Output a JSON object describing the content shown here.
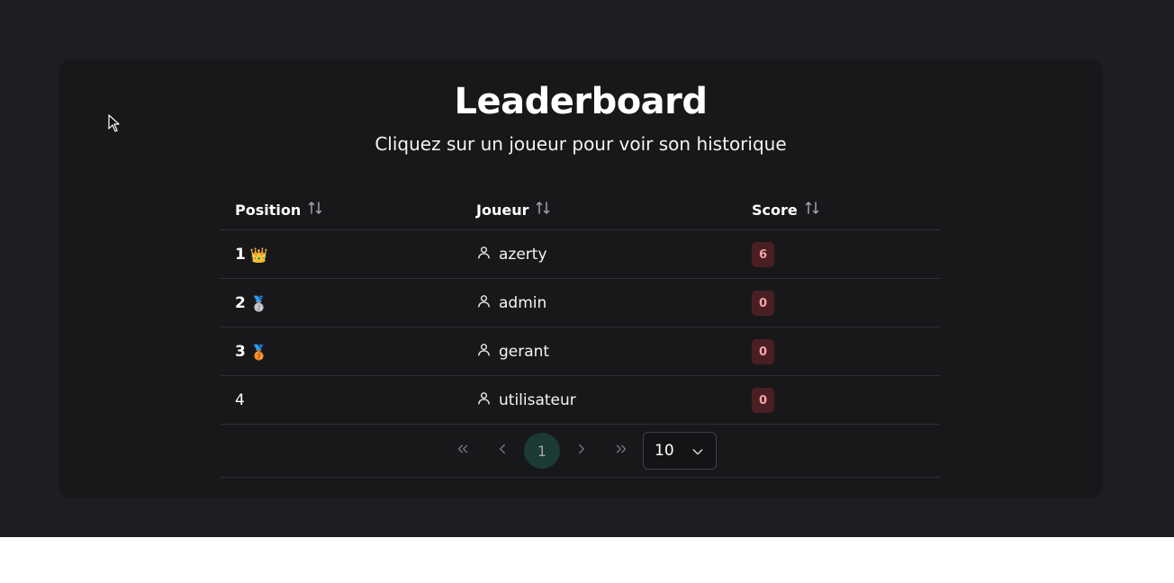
{
  "header": {
    "title": "Leaderboard",
    "subtitle": "Cliquez sur un joueur pour voir son historique"
  },
  "table": {
    "columns": [
      {
        "label": "Position",
        "icon": "sort-icon"
      },
      {
        "label": "Joueur",
        "icon": "sort-icon"
      },
      {
        "label": "Score",
        "icon": "sort-icon"
      }
    ],
    "rows": [
      {
        "position": "1",
        "medal": "👑",
        "medal_icon": "crown-icon",
        "player": "azerty",
        "score": "6"
      },
      {
        "position": "2",
        "medal": "🥈",
        "medal_icon": "silver-medal-icon",
        "player": "admin",
        "score": "0"
      },
      {
        "position": "3",
        "medal": "🥉",
        "medal_icon": "bronze-medal-icon",
        "player": "gerant",
        "score": "0"
      },
      {
        "position": "4",
        "medal": "",
        "medal_icon": "",
        "player": "utilisateur",
        "score": "0"
      }
    ]
  },
  "pagination": {
    "current_page": "1",
    "page_size": "10"
  },
  "colors": {
    "background": "#1e1d23",
    "card": "#18181b",
    "score_badge_bg": "#4a1f23",
    "score_badge_text": "#f6a3a3",
    "active_page_bg": "#1c3a34"
  }
}
